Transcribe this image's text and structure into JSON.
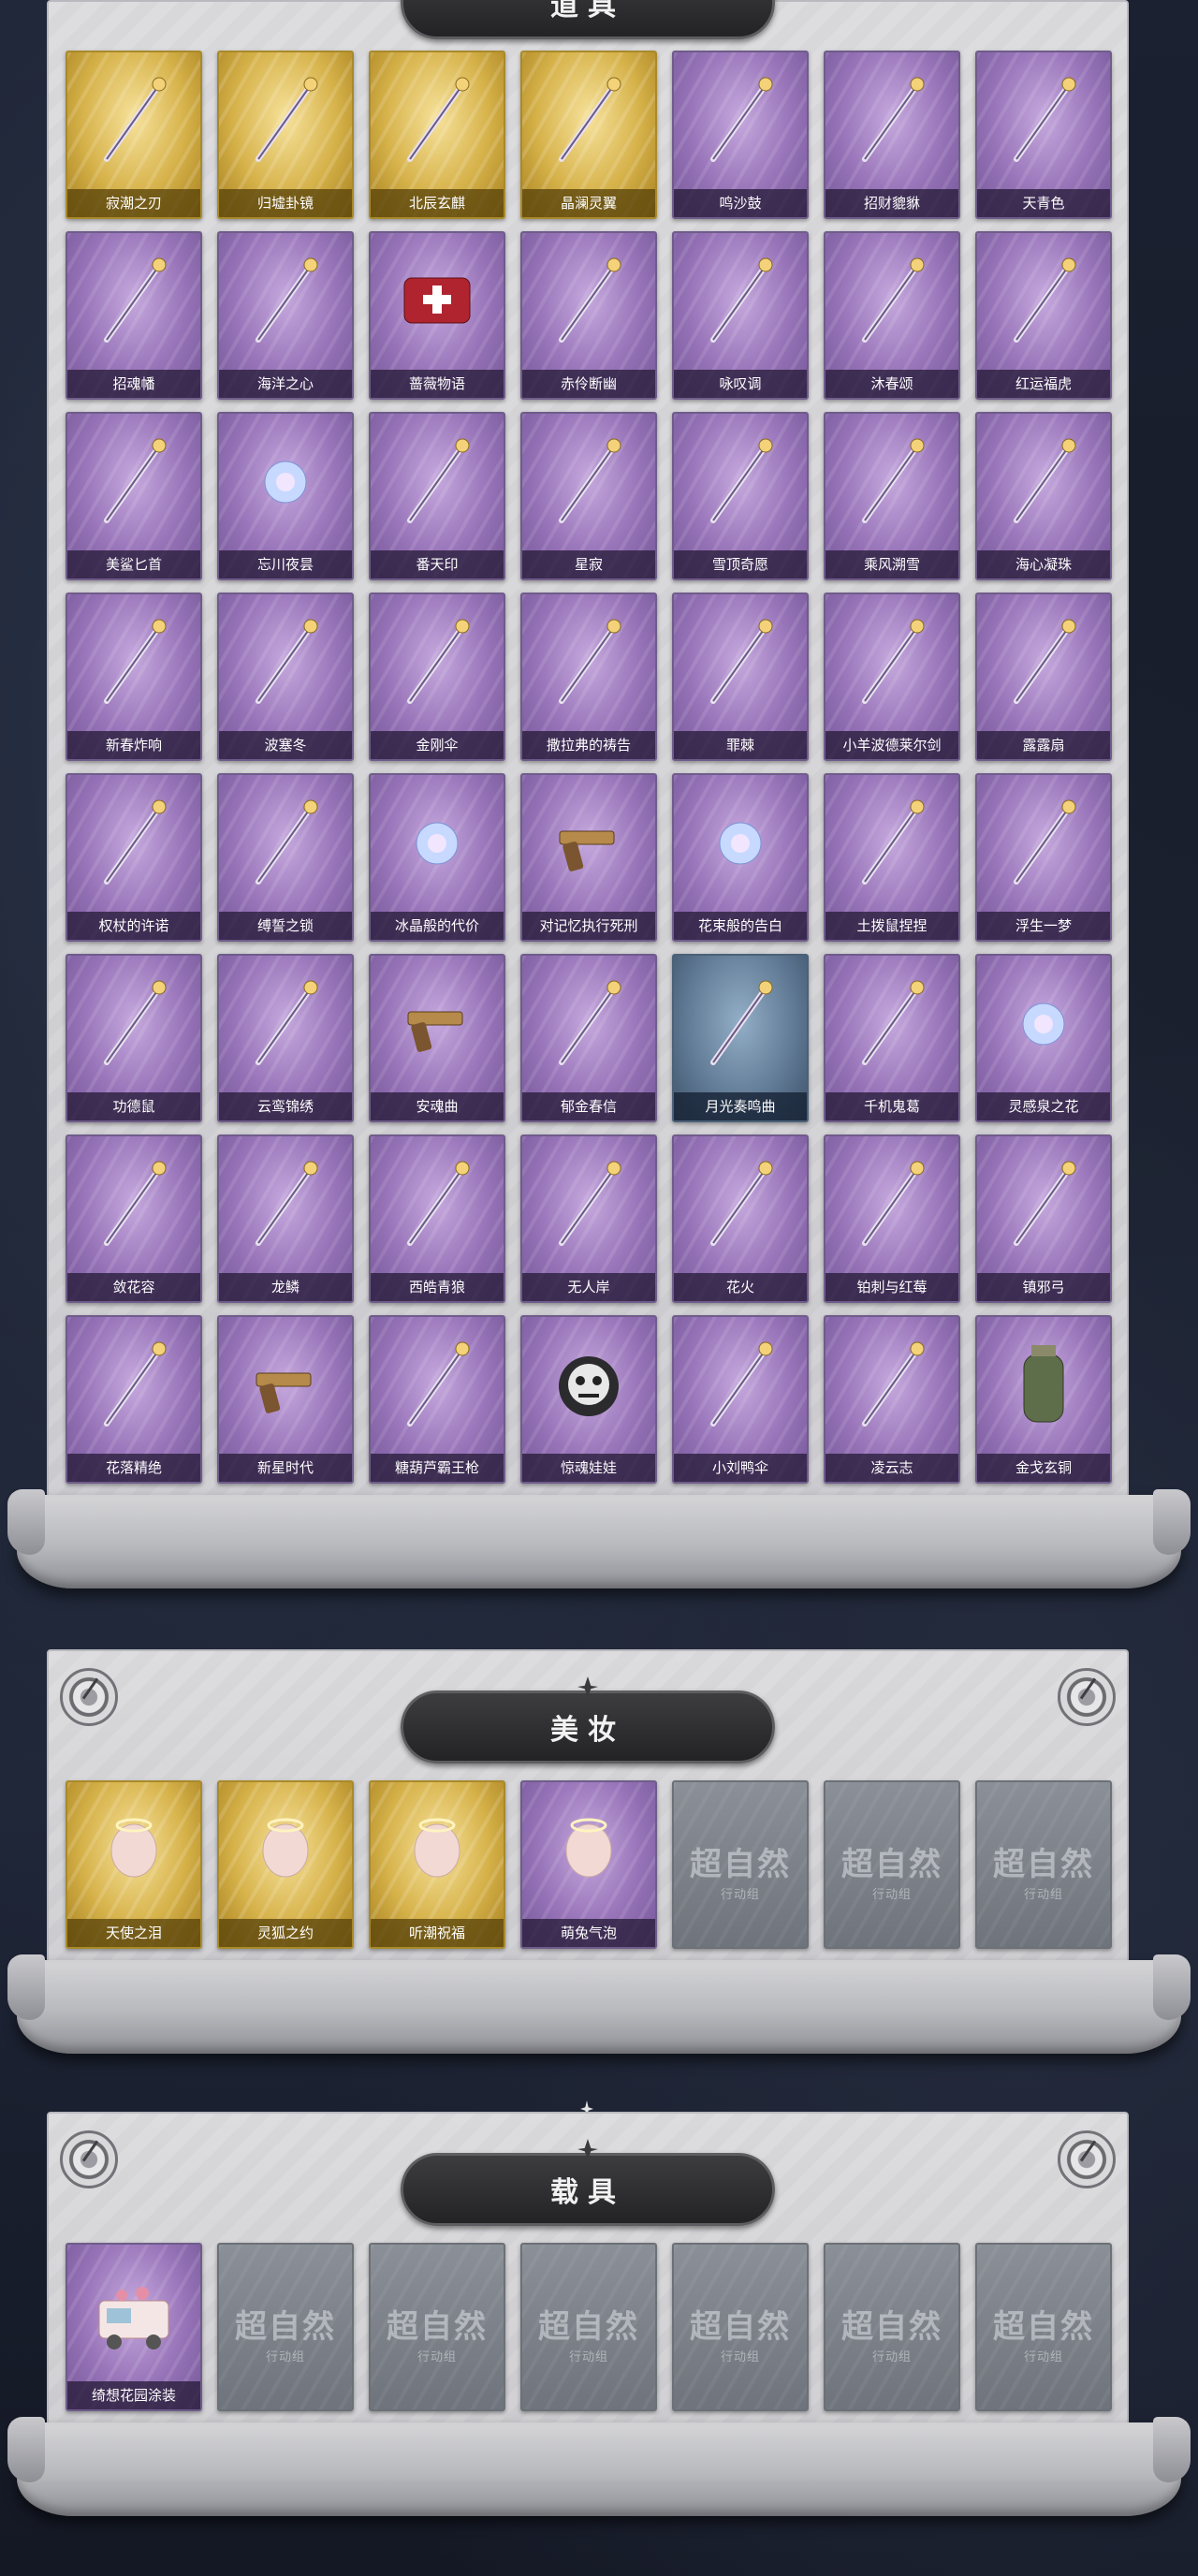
{
  "sections": {
    "items": {
      "title": "道具",
      "cards": [
        {
          "label": "寂潮之刃",
          "tier": "gold",
          "icon": "blade-icon"
        },
        {
          "label": "归墟卦镜",
          "tier": "gold",
          "icon": "mirror-icon"
        },
        {
          "label": "北辰玄麒",
          "tier": "gold",
          "icon": "qilin-icon"
        },
        {
          "label": "晶澜灵翼",
          "tier": "gold",
          "icon": "wing-icon"
        },
        {
          "label": "鸣沙鼓",
          "tier": "purple",
          "icon": "drum-icon"
        },
        {
          "label": "招财貔貅",
          "tier": "purple",
          "icon": "beast-icon"
        },
        {
          "label": "天青色",
          "tier": "purple",
          "icon": "scepter-icon"
        },
        {
          "label": "招魂幡",
          "tier": "purple",
          "icon": "banner-icon"
        },
        {
          "label": "海洋之心",
          "tier": "purple",
          "icon": "pendant-icon"
        },
        {
          "label": "蔷薇物语",
          "tier": "purple",
          "icon": "medkit-icon"
        },
        {
          "label": "赤伶断幽",
          "tier": "purple",
          "icon": "knife-icon"
        },
        {
          "label": "咏叹调",
          "tier": "purple",
          "icon": "birdcage-icon"
        },
        {
          "label": "沐春颂",
          "tier": "purple",
          "icon": "flower-branch-icon"
        },
        {
          "label": "红运福虎",
          "tier": "purple",
          "icon": "tiger-icon"
        },
        {
          "label": "美鲨匕首",
          "tier": "purple",
          "icon": "shark-dagger-icon"
        },
        {
          "label": "忘川夜昙",
          "tier": "purple",
          "icon": "lotus-icon"
        },
        {
          "label": "番天印",
          "tier": "purple",
          "icon": "seal-icon"
        },
        {
          "label": "星寂",
          "tier": "purple",
          "icon": "telescope-icon"
        },
        {
          "label": "雪顶奇愿",
          "tier": "purple",
          "icon": "teacup-icon"
        },
        {
          "label": "乘风溯雪",
          "tier": "purple",
          "icon": "lantern-icon"
        },
        {
          "label": "海心凝珠",
          "tier": "purple",
          "icon": "pearl-shell-icon"
        },
        {
          "label": "新春炸响",
          "tier": "purple",
          "icon": "firecracker-icon"
        },
        {
          "label": "波塞冬",
          "tier": "purple",
          "icon": "trident-icon"
        },
        {
          "label": "金刚伞",
          "tier": "purple",
          "icon": "umbrella-icon"
        },
        {
          "label": "撒拉弗的祷告",
          "tier": "purple",
          "icon": "fork-staff-icon"
        },
        {
          "label": "罪棘",
          "tier": "purple",
          "icon": "spear-icon"
        },
        {
          "label": "小羊波德莱尔剑",
          "tier": "purple",
          "icon": "sword-icon"
        },
        {
          "label": "露露扇",
          "tier": "purple",
          "icon": "fan-icon"
        },
        {
          "label": "权杖的许诺",
          "tier": "purple",
          "icon": "scepter-icon"
        },
        {
          "label": "缚誓之锁",
          "tier": "purple",
          "icon": "chain-icon"
        },
        {
          "label": "冰晶般的代价",
          "tier": "purple",
          "icon": "ice-flower-icon"
        },
        {
          "label": "对记忆执行死刑",
          "tier": "purple",
          "icon": "revolver-icon"
        },
        {
          "label": "花束般的告白",
          "tier": "purple",
          "icon": "rose-icon"
        },
        {
          "label": "土拨鼠捏捏",
          "tier": "purple",
          "icon": "groundhog-icon"
        },
        {
          "label": "浮生一梦",
          "tier": "purple",
          "icon": "scroll-icon"
        },
        {
          "label": "功德鼠",
          "tier": "purple",
          "icon": "hamster-icon"
        },
        {
          "label": "云鸾锦绣",
          "tier": "purple",
          "icon": "phoenix-icon"
        },
        {
          "label": "安魂曲",
          "tier": "purple",
          "icon": "shotgun-icon"
        },
        {
          "label": "郁金春信",
          "tier": "purple",
          "icon": "parasol-icon"
        },
        {
          "label": "月光奏鸣曲",
          "tier": "blue",
          "icon": "piano-icon"
        },
        {
          "label": "千机鬼葛",
          "tier": "purple",
          "icon": "vine-staff-icon"
        },
        {
          "label": "灵感泉之花",
          "tier": "purple",
          "icon": "bouquet-icon"
        },
        {
          "label": "敛花容",
          "tier": "purple",
          "icon": "flower-chain-icon"
        },
        {
          "label": "龙鳞",
          "tier": "purple",
          "icon": "shovel-icon"
        },
        {
          "label": "西皓青狼",
          "tier": "purple",
          "icon": "gold-whip-icon"
        },
        {
          "label": "无人岸",
          "tier": "purple",
          "icon": "potion-icon"
        },
        {
          "label": "花火",
          "tier": "purple",
          "icon": "sparkler-icon"
        },
        {
          "label": "铂刺与红莓",
          "tier": "purple",
          "icon": "sickle-icon"
        },
        {
          "label": "镇邪弓",
          "tier": "purple",
          "icon": "bow-icon"
        },
        {
          "label": "花落精绝",
          "tier": "purple",
          "icon": "necklace-icon"
        },
        {
          "label": "新星时代",
          "tier": "purple",
          "icon": "pistol-icon"
        },
        {
          "label": "糖葫芦霸王枪",
          "tier": "purple",
          "icon": "candy-spear-icon"
        },
        {
          "label": "惊魂娃娃",
          "tier": "purple",
          "icon": "skull-doll-icon"
        },
        {
          "label": "小刘鸭伞",
          "tier": "purple",
          "icon": "duck-umbrella-icon"
        },
        {
          "label": "凌云志",
          "tier": "purple",
          "icon": "crossbow-icon"
        },
        {
          "label": "金戈玄铜",
          "tier": "purple",
          "icon": "grenade-icon"
        }
      ]
    },
    "makeup": {
      "title": "美妆",
      "cards": [
        {
          "label": "天使之泪",
          "tier": "gold",
          "icon": "angel-head-icon"
        },
        {
          "label": "灵狐之约",
          "tier": "gold",
          "icon": "fox-head-icon"
        },
        {
          "label": "听潮祝福",
          "tier": "gold",
          "icon": "fin-head-icon"
        },
        {
          "label": "萌兔气泡",
          "tier": "purple",
          "icon": "bunny-head-icon"
        },
        {
          "label": "",
          "tier": "locked",
          "icon": "placeholder-icon"
        },
        {
          "label": "",
          "tier": "locked",
          "icon": "placeholder-icon"
        },
        {
          "label": "",
          "tier": "locked",
          "icon": "placeholder-icon"
        }
      ]
    },
    "vehicle": {
      "title": "载具",
      "cards": [
        {
          "label": "绮想花园涂装",
          "tier": "purple",
          "icon": "food-truck-icon"
        },
        {
          "label": "",
          "tier": "locked",
          "icon": "placeholder-icon"
        },
        {
          "label": "",
          "tier": "locked",
          "icon": "placeholder-icon"
        },
        {
          "label": "",
          "tier": "locked",
          "icon": "placeholder-icon"
        },
        {
          "label": "",
          "tier": "locked",
          "icon": "placeholder-icon"
        },
        {
          "label": "",
          "tier": "locked",
          "icon": "placeholder-icon"
        },
        {
          "label": "",
          "tier": "locked",
          "icon": "placeholder-icon"
        }
      ]
    }
  },
  "placeholder_text": {
    "main": "超自然",
    "sub": "行动组"
  },
  "colors": {
    "gold": "#d6b24a",
    "purple": "#9773b8",
    "blue": "#5e7792",
    "locked": "#7b8088",
    "banner": "#2b2b2e"
  }
}
